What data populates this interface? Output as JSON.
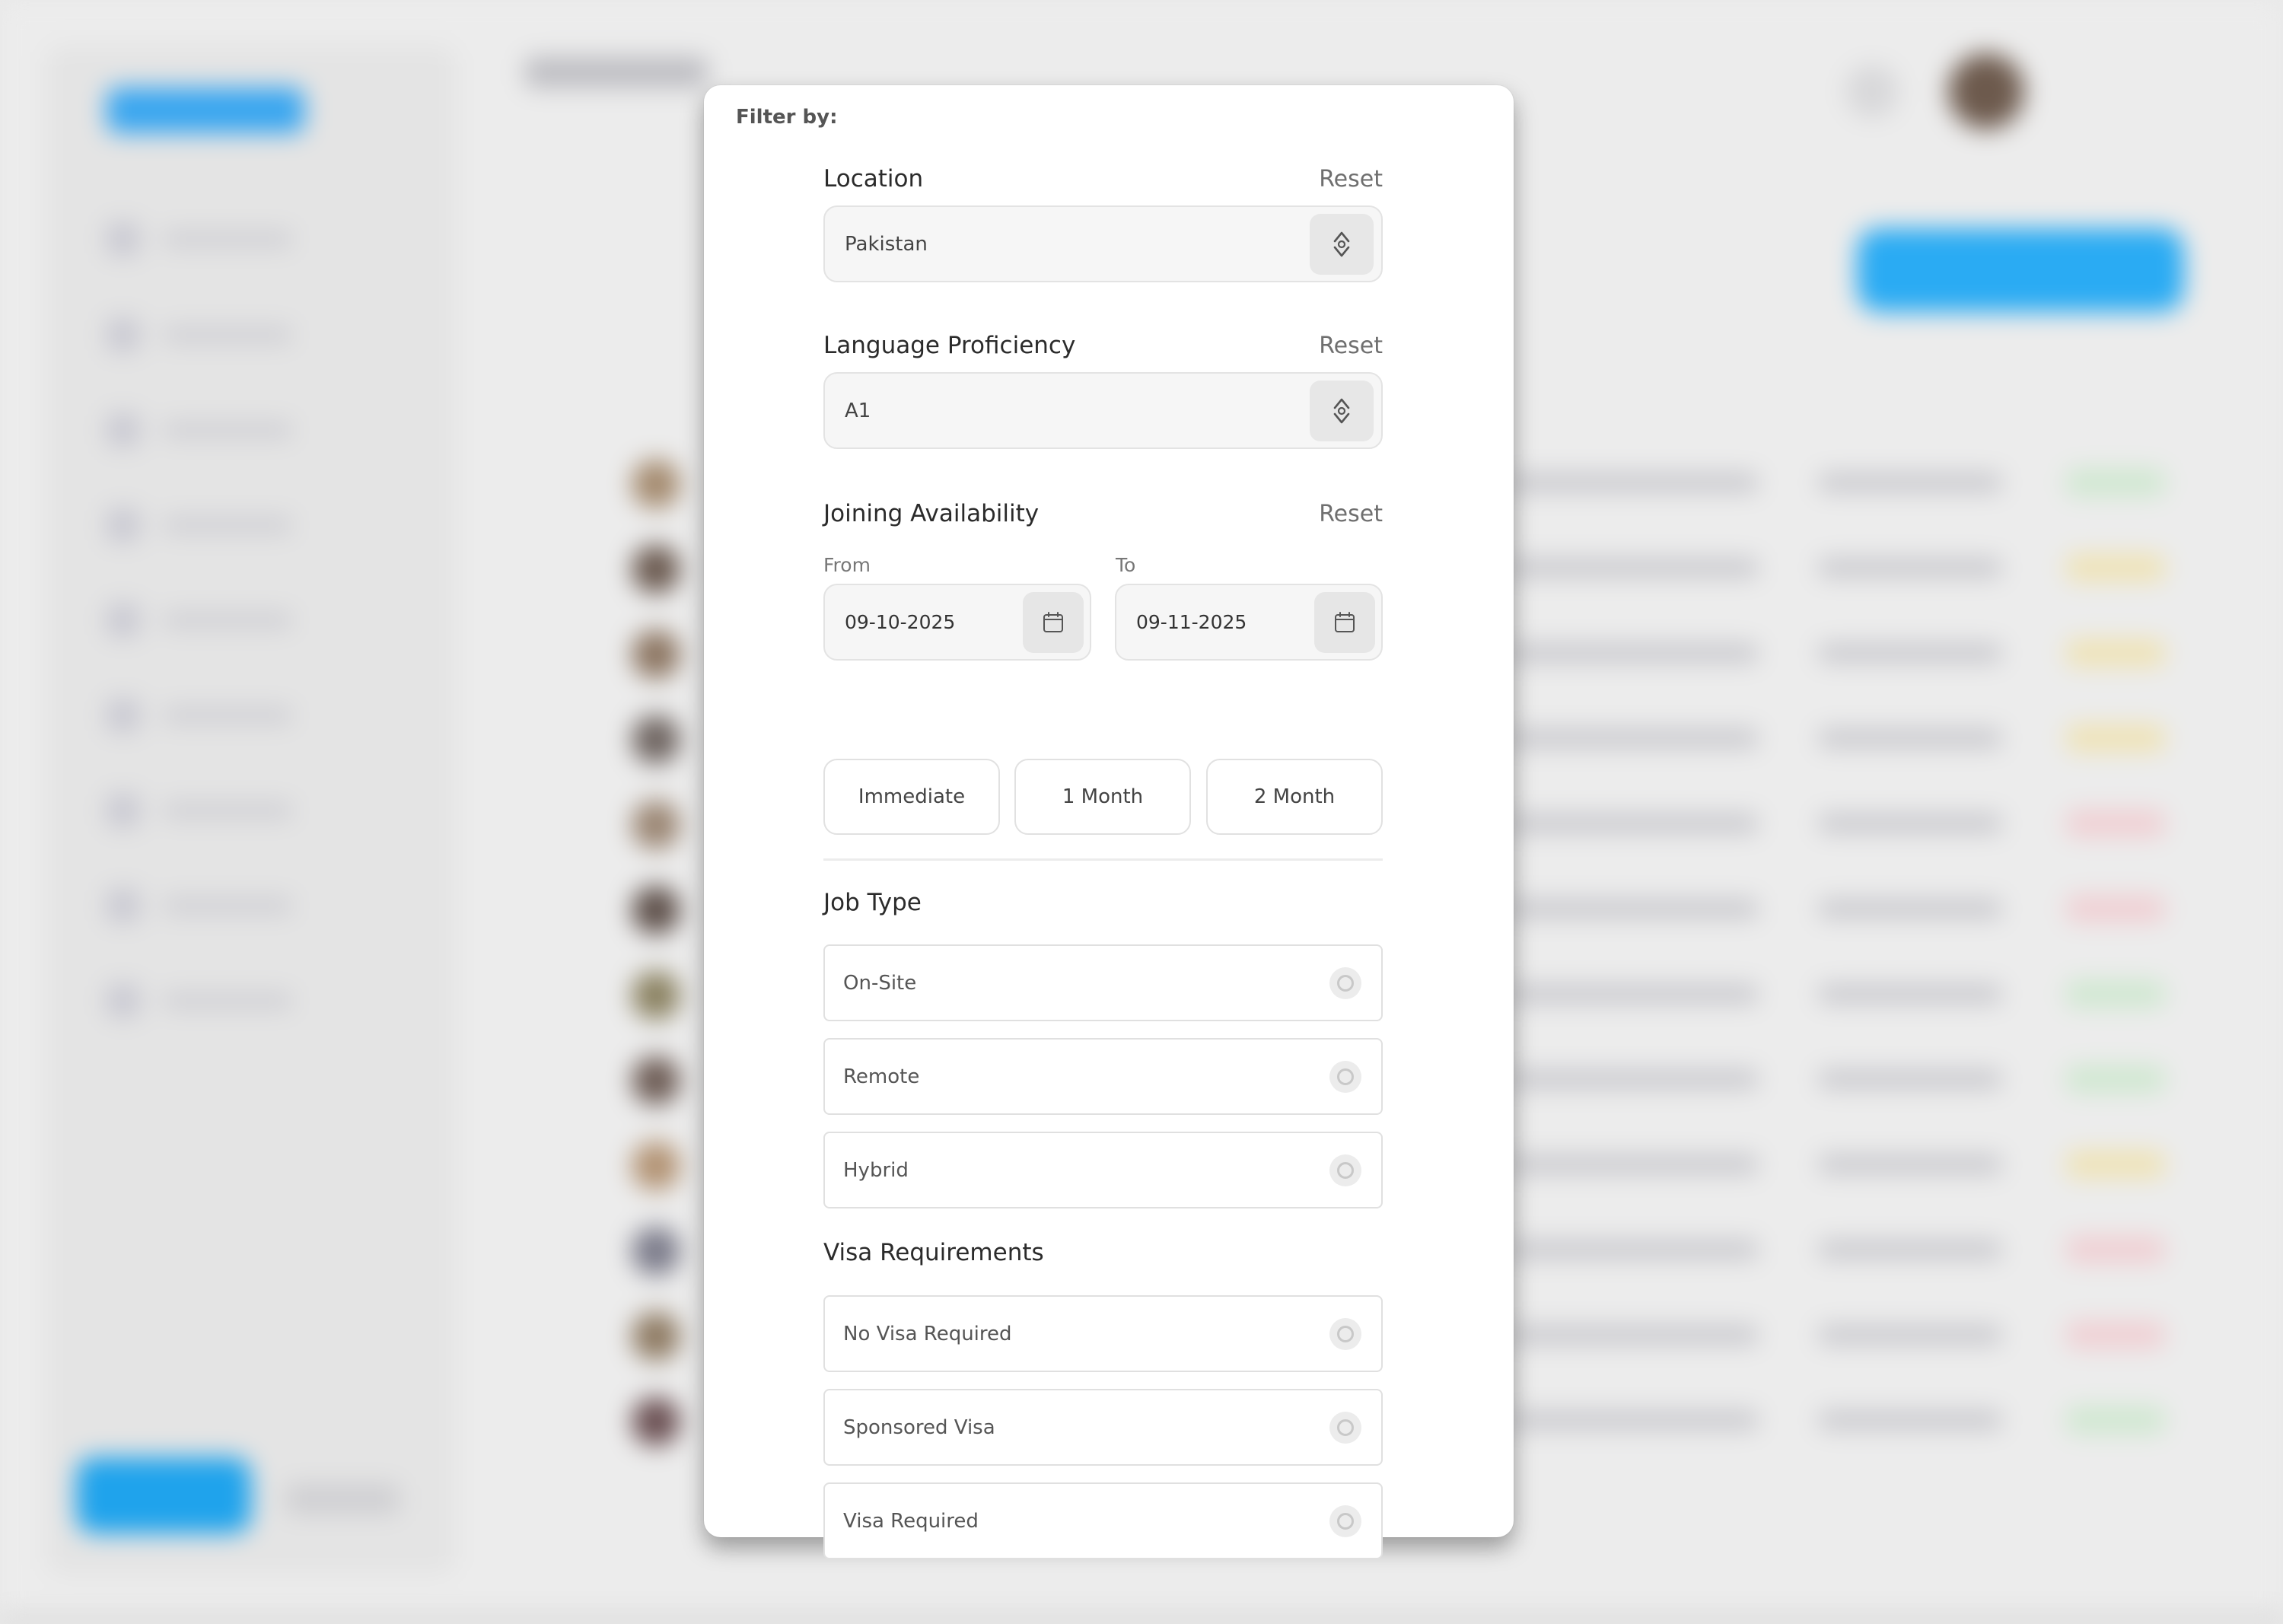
{
  "filter_modal": {
    "title": "Filter by:",
    "reset_label": "Reset",
    "location": {
      "title": "Location",
      "value": "Pakistan"
    },
    "language": {
      "title": "Language Proficiency",
      "value": "A1"
    },
    "joining": {
      "title": "Joining Availability",
      "from_label": "From",
      "to_label": "To",
      "from_value": "09-10-2025",
      "to_value": "09-11-2025",
      "quick_options": [
        "Immediate",
        "1 Month",
        "2 Month"
      ]
    },
    "job_type": {
      "title": "Job Type",
      "options": [
        "On-Site",
        "Remote",
        "Hybrid"
      ]
    },
    "visa": {
      "title": "Visa Requirements",
      "options": [
        "No Visa Required",
        "Sponsored Visa",
        "Visa Required"
      ]
    }
  },
  "colors": {
    "accent": "#1fa3ec",
    "modal_bg": "#ffffff",
    "overlay_bg": "#ececec"
  }
}
